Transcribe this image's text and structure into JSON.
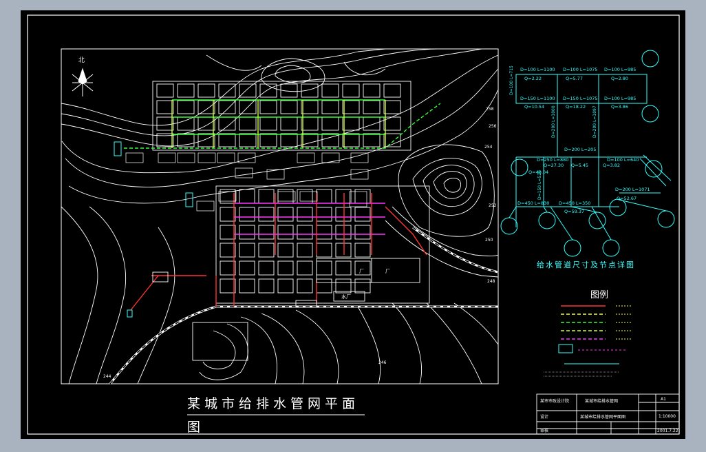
{
  "drawing": {
    "title_line1": "某城市给排水管网平面",
    "title_line2": "图",
    "detail_caption": "给水管道尺寸及节点详图",
    "legend_title": "图例"
  },
  "pipe_labels": {
    "row1": [
      "D=100 L=1100",
      "D=100 L=1075",
      "D=100 L=985"
    ],
    "row1_sub": [
      "Q=2.22",
      "Q=5.77",
      "Q=2.80"
    ],
    "row2": [
      "D=150 L=1100",
      "D=150 L=1075",
      "D=100 L=985"
    ],
    "row2_sub": [
      "Q=10.54",
      "Q=18.22",
      "Q=3.86"
    ],
    "row3": [
      "D=250 L=880",
      "D=200 L=205",
      "D=100 L=640"
    ],
    "row3_sub": [
      "Q=40.04",
      "Q=27.30",
      "Q=5.45",
      "Q=3.82"
    ],
    "row4": [
      "D=450 L=830",
      "D=450 L=350",
      "D=200 L=1071"
    ],
    "row4_sub": [
      "Q=59.37",
      "Q=52.67"
    ],
    "vertical": [
      "D=100 L=715",
      "D=200 L=1000",
      "D=200 L=1097",
      "D=150 L=520"
    ]
  },
  "map_labels": {
    "north": "北",
    "plant_a": "厂",
    "plant_b": "厂",
    "station": "水厂",
    "contours": [
      "258",
      "256",
      "254",
      "252",
      "250",
      "248",
      "246",
      "244"
    ]
  },
  "title_block": {
    "cells": [
      "某市市政设计院",
      "某城市给排水管网",
      "A1",
      "设计",
      "1:10000",
      "审核",
      "某城市给排水管网平面图",
      "2001.7.22"
    ]
  },
  "colors": {
    "background": "#000000",
    "frame": "#ffffff",
    "water_pipe": "#ff3333",
    "drain_pipe": "#ffff33",
    "green_pipe": "#33ff33",
    "magenta": "#ff33ff",
    "cyan": "#33ffff",
    "outer": "#a9b3c0"
  }
}
